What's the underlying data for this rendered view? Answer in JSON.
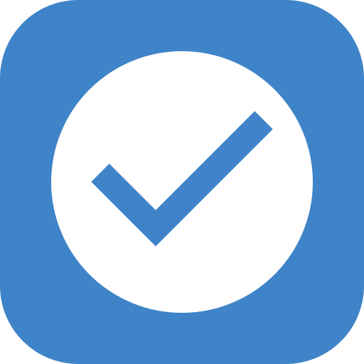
{
  "icon": {
    "name": "checkmark-app-icon",
    "symbol": "check-icon",
    "colors": {
      "background": "#3f84c8",
      "circle": "#ffffff",
      "check": "#3f84c8"
    }
  }
}
